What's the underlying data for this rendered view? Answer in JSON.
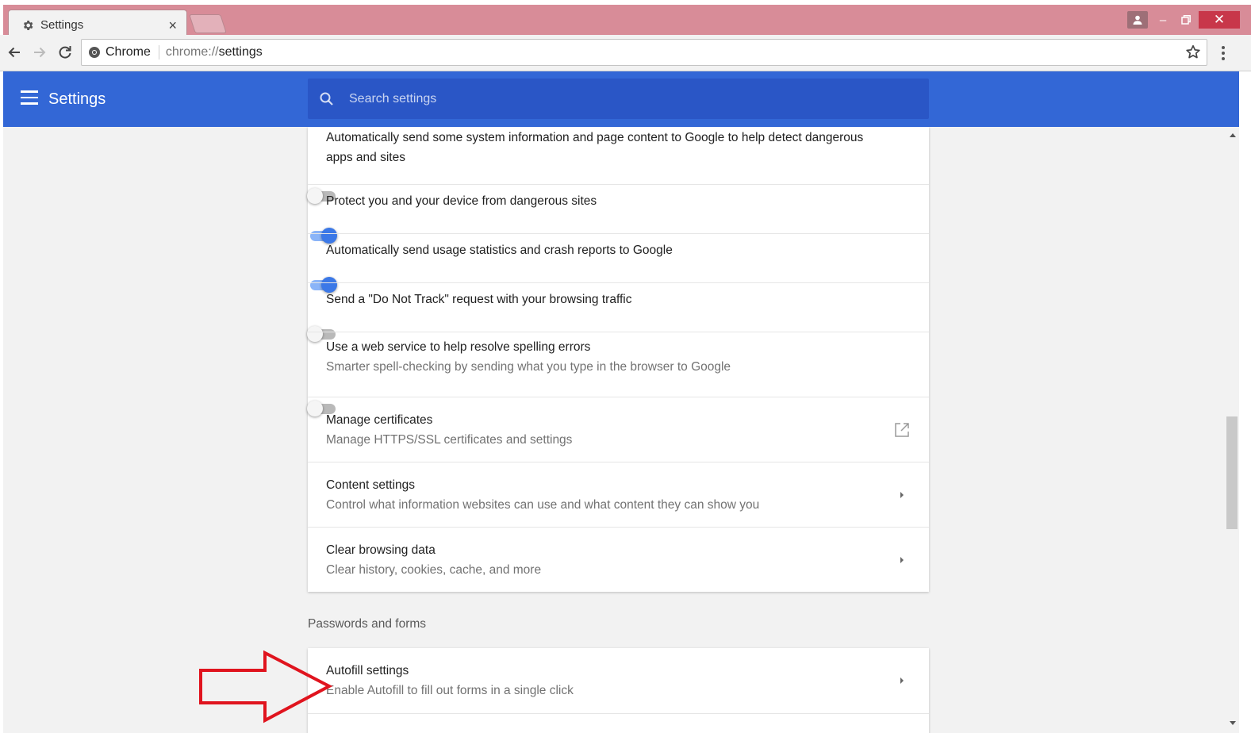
{
  "colors": {
    "header_blue": "#3367d6",
    "search_blue": "#2a56c6",
    "toggle_on": "#3b78e7",
    "titlebar": "#d88c98",
    "annotation_arrow": "#e0141e"
  },
  "browser": {
    "tab_title": "Settings",
    "tab_close": "×",
    "tab_icon": "gear-icon",
    "omnibox_chip": "Chrome",
    "url_scheme": "chrome://",
    "url_path": "settings",
    "window_close": "✕",
    "window_min": "–"
  },
  "header": {
    "title": "Settings",
    "search_placeholder": "Search settings"
  },
  "privacy_rows": [
    {
      "title": "Automatically send some system information and page content to Google to help detect dangerous apps and sites",
      "subtitle": "",
      "control": "toggle",
      "state": "off"
    },
    {
      "title": "Protect you and your device from dangerous sites",
      "subtitle": "",
      "control": "toggle",
      "state": "on"
    },
    {
      "title": "Automatically send usage statistics and crash reports to Google",
      "subtitle": "",
      "control": "toggle",
      "state": "on"
    },
    {
      "title": "Send a \"Do Not Track\" request with your browsing traffic",
      "subtitle": "",
      "control": "toggle",
      "state": "off"
    },
    {
      "title": "Use a web service to help resolve spelling errors",
      "subtitle": "Smarter spell-checking by sending what you type in the browser to Google",
      "control": "toggle",
      "state": "off"
    },
    {
      "title": "Manage certificates",
      "subtitle": "Manage HTTPS/SSL certificates and settings",
      "control": "external-link-icon"
    },
    {
      "title": "Content settings",
      "subtitle": "Control what information websites can use and what content they can show you",
      "control": "chevron-right-icon"
    },
    {
      "title": "Clear browsing data",
      "subtitle": "Clear history, cookies, cache, and more",
      "control": "chevron-right-icon"
    }
  ],
  "passwords_section": {
    "title": "Passwords and forms",
    "rows": [
      {
        "title": "Autofill settings",
        "subtitle": "Enable Autofill to fill out forms in a single click",
        "control": "chevron-right-icon"
      }
    ]
  }
}
